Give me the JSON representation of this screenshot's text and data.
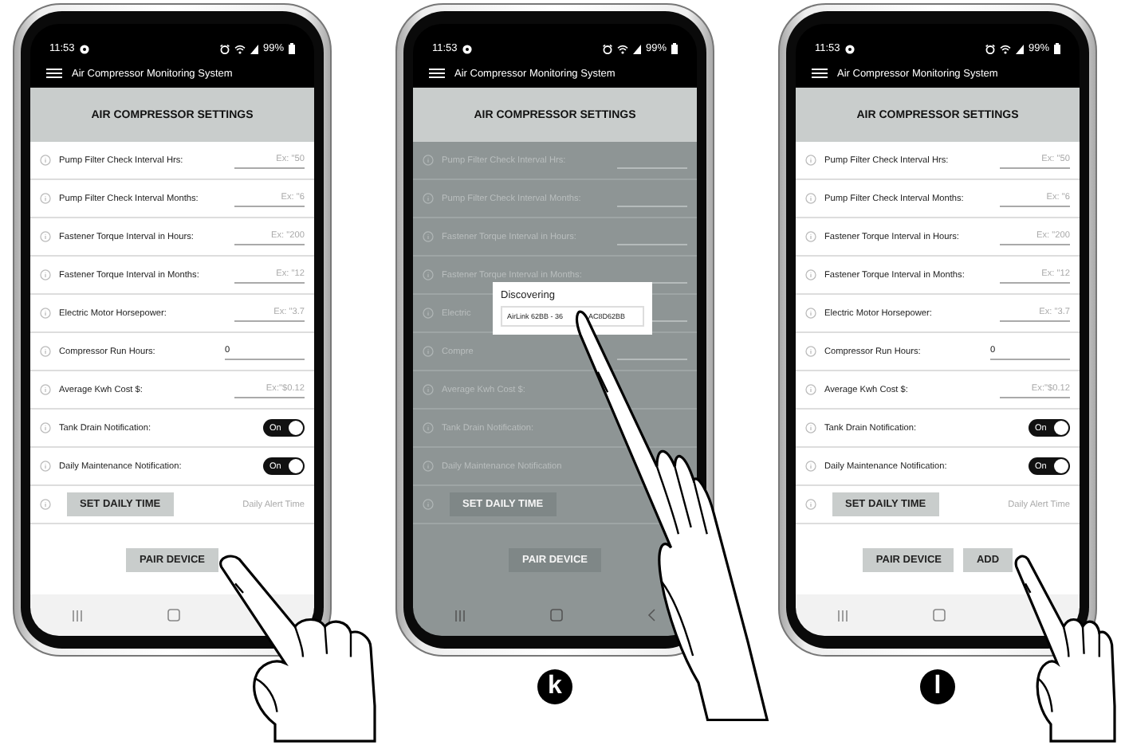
{
  "phones": [
    {
      "status_bar": {
        "time": "11:53",
        "battery": "99%"
      },
      "app_title": "Air Compressor Monitoring System",
      "header": "AIR COMPRESSOR SETTINGS",
      "dimmed": false,
      "rows": [
        {
          "kind": "input",
          "label": "Pump Filter Check Interval Hrs:",
          "placeholder": "Ex: \"50"
        },
        {
          "kind": "input",
          "label": "Pump Filter Check Interval Months:",
          "placeholder": "Ex: \"6"
        },
        {
          "kind": "input",
          "label": "Fastener Torque Interval in Hours:",
          "placeholder": "Ex: \"200"
        },
        {
          "kind": "input",
          "label": "Fastener Torque Interval in Months:",
          "placeholder": "Ex: \"12"
        },
        {
          "kind": "input",
          "label": "Electric Motor Horsepower:",
          "placeholder": "Ex: \"3.7"
        },
        {
          "kind": "input",
          "label": "Compressor Run Hours:",
          "value": "0"
        },
        {
          "kind": "input",
          "label": "Average Kwh Cost $:",
          "placeholder": "Ex:\"$0.12"
        },
        {
          "kind": "toggle",
          "label": "Tank Drain Notification:",
          "on": true,
          "toggle_text": "On"
        },
        {
          "kind": "toggle",
          "label": "Daily Maintenance Notification:",
          "on": true,
          "toggle_text": "On"
        },
        {
          "kind": "time",
          "button": "SET DAILY TIME",
          "note": "Daily Alert Time"
        }
      ],
      "actions": [
        "PAIR DEVICE"
      ],
      "back_button_visible": false
    },
    {
      "status_bar": {
        "time": "11:53",
        "battery": "99%"
      },
      "app_title": "Air Compressor Monitoring System",
      "header": "AIR COMPRESSOR SETTINGS",
      "dimmed": true,
      "rows": [
        {
          "kind": "input",
          "label": "Pump Filter Check Interval Hrs:"
        },
        {
          "kind": "input",
          "label": "Pump Filter Check Interval Months:"
        },
        {
          "kind": "input",
          "label": "Fastener Torque Interval in Hours:"
        },
        {
          "kind": "input",
          "label": "Fastener Torque Interval in Months:"
        },
        {
          "kind": "input",
          "label": "Electric"
        },
        {
          "kind": "input",
          "label": "Compre"
        },
        {
          "kind": "text",
          "label": "Average Kwh Cost $:"
        },
        {
          "kind": "text",
          "label": "Tank Drain Notification:"
        },
        {
          "kind": "text",
          "label": "Daily Maintenance Notification"
        },
        {
          "kind": "time",
          "button": "SET DAILY TIME"
        }
      ],
      "actions": [
        "PAIR DEVICE"
      ],
      "back_button_visible": true,
      "dialog": {
        "title": "Discovering",
        "item_start": "AirLink 62BB - 36",
        "item_end": "AC8D62BB"
      },
      "step_label": "k"
    },
    {
      "status_bar": {
        "time": "11:53",
        "battery": "99%"
      },
      "app_title": "Air Compressor Monitoring System",
      "header": "AIR COMPRESSOR SETTINGS",
      "dimmed": false,
      "rows": [
        {
          "kind": "input",
          "label": "Pump Filter Check Interval Hrs:",
          "placeholder": "Ex: \"50"
        },
        {
          "kind": "input",
          "label": "Pump Filter Check Interval Months:",
          "placeholder": "Ex: \"6"
        },
        {
          "kind": "input",
          "label": "Fastener Torque Interval in Hours:",
          "placeholder": "Ex: \"200"
        },
        {
          "kind": "input",
          "label": "Fastener Torque Interval in Months:",
          "placeholder": "Ex: \"12"
        },
        {
          "kind": "input",
          "label": "Electric Motor Horsepower:",
          "placeholder": "Ex: \"3.7"
        },
        {
          "kind": "input",
          "label": "Compressor Run Hours:",
          "value": "0"
        },
        {
          "kind": "input",
          "label": "Average Kwh Cost $:",
          "placeholder": "Ex:\"$0.12"
        },
        {
          "kind": "toggle",
          "label": "Tank Drain Notification:",
          "on": true,
          "toggle_text": "On"
        },
        {
          "kind": "toggle",
          "label": "Daily Maintenance Notification:",
          "on": true,
          "toggle_text": "On"
        },
        {
          "kind": "time",
          "button": "SET DAILY TIME",
          "note": "Daily Alert Time"
        }
      ],
      "actions": [
        "PAIR DEVICE",
        "ADD"
      ],
      "back_button_visible": false,
      "step_label": "l"
    }
  ]
}
